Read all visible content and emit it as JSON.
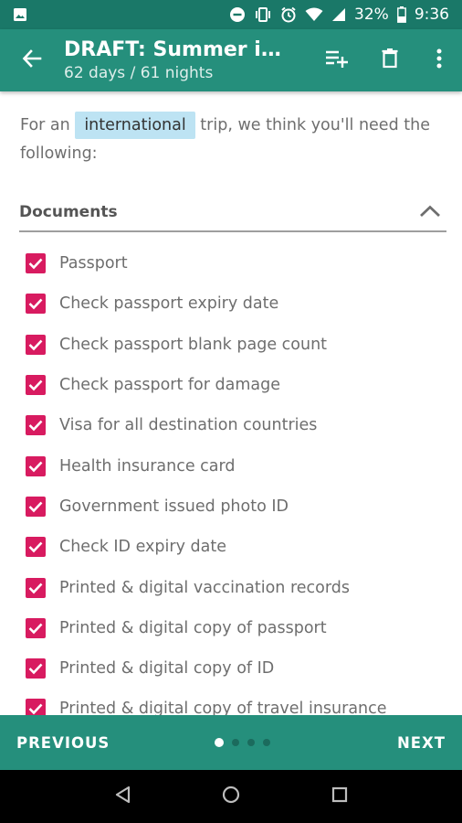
{
  "status_bar": {
    "battery": "32%",
    "time": "9:36",
    "icons": [
      "image-icon",
      "dnd-icon",
      "vibrate-icon",
      "alarm-icon",
      "wifi-icon",
      "signal-icon",
      "battery-icon"
    ]
  },
  "app_bar": {
    "title": "DRAFT: Summer in…",
    "subtitle": "62 days / 61 nights",
    "actions": [
      "add-to-list-icon",
      "delete-icon",
      "more-vert-icon"
    ]
  },
  "intro": {
    "prefix": "For an",
    "chip": "international",
    "suffix": "trip, we think you'll need the following:"
  },
  "section": {
    "label": "Documents",
    "expanded": true
  },
  "items": [
    {
      "label": "Passport",
      "checked": true
    },
    {
      "label": "Check passport expiry date",
      "checked": true
    },
    {
      "label": "Check passport blank page count",
      "checked": true
    },
    {
      "label": "Check passport for damage",
      "checked": true
    },
    {
      "label": "Visa for all destination countries",
      "checked": true
    },
    {
      "label": "Health insurance card",
      "checked": true
    },
    {
      "label": "Government issued photo ID",
      "checked": true
    },
    {
      "label": "Check ID expiry date",
      "checked": true
    },
    {
      "label": "Printed & digital vaccination records",
      "checked": true
    },
    {
      "label": "Printed & digital copy of passport",
      "checked": true
    },
    {
      "label": "Printed & digital copy of ID",
      "checked": true
    },
    {
      "label": "Printed & digital copy of travel insurance",
      "checked": true
    }
  ],
  "bottom_nav": {
    "previous": "PREVIOUS",
    "next": "NEXT",
    "page_count": 4,
    "current_page": 1
  },
  "colors": {
    "primary": "#258f7c",
    "primary_dark": "#1a7868",
    "accent": "#d81b60",
    "chip_bg": "#bde3f3"
  }
}
